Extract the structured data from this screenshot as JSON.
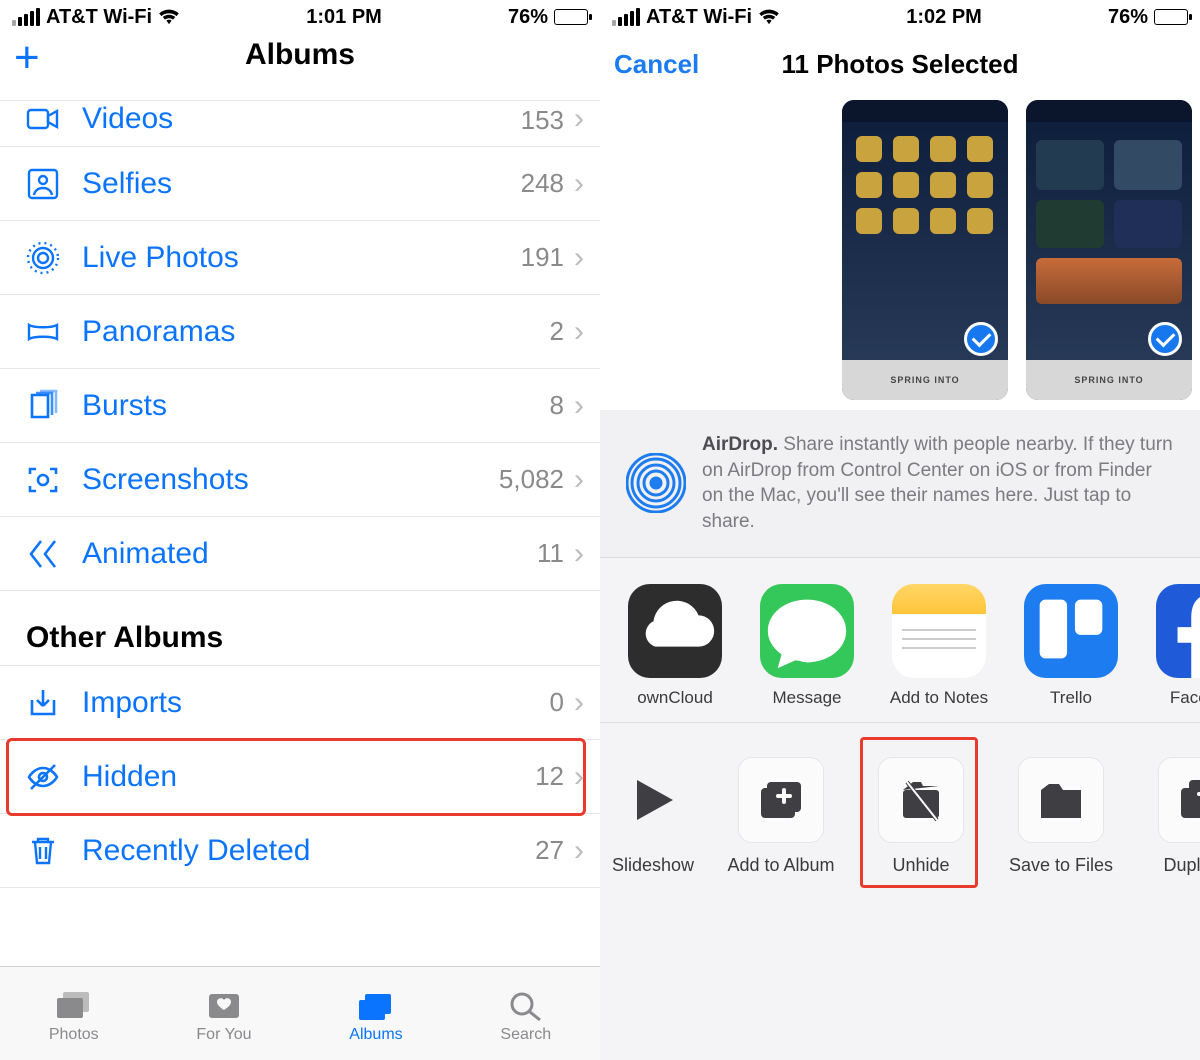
{
  "left": {
    "status": {
      "carrier": "AT&T Wi-Fi",
      "time": "1:01 PM",
      "battery": "76%"
    },
    "nav": {
      "title": "Albums"
    },
    "media_types": [
      {
        "icon": "video-icon",
        "name": "Videos",
        "count": "153"
      },
      {
        "icon": "selfie-icon",
        "name": "Selfies",
        "count": "248"
      },
      {
        "icon": "livephoto-icon",
        "name": "Live Photos",
        "count": "191"
      },
      {
        "icon": "panorama-icon",
        "name": "Panoramas",
        "count": "2"
      },
      {
        "icon": "burst-icon",
        "name": "Bursts",
        "count": "8"
      },
      {
        "icon": "screenshot-icon",
        "name": "Screenshots",
        "count": "5,082"
      },
      {
        "icon": "animated-icon",
        "name": "Animated",
        "count": "11"
      }
    ],
    "other_section_title": "Other Albums",
    "other_albums": [
      {
        "icon": "import-icon",
        "name": "Imports",
        "count": "0"
      },
      {
        "icon": "hidden-icon",
        "name": "Hidden",
        "count": "12",
        "highlighted": true
      },
      {
        "icon": "trash-icon",
        "name": "Recently Deleted",
        "count": "27"
      }
    ],
    "tabs": [
      {
        "name": "Photos",
        "active": false
      },
      {
        "name": "For You",
        "active": false
      },
      {
        "name": "Albums",
        "active": true
      },
      {
        "name": "Search",
        "active": false
      }
    ]
  },
  "right": {
    "status": {
      "carrier": "AT&T Wi-Fi",
      "time": "1:02 PM",
      "battery": "76%"
    },
    "nav": {
      "cancel": "Cancel",
      "title": "11 Photos Selected"
    },
    "airdrop_bold": "AirDrop.",
    "airdrop_text": " Share instantly with people nearby. If they turn on AirDrop from Control Center on iOS or from Finder on the Mac, you'll see their names here. Just tap to share.",
    "apps": [
      {
        "name": "ownCloud",
        "bg": "#2d2d2d",
        "glyph": "cloud"
      },
      {
        "name": "Message",
        "bg": "#34c759",
        "glyph": "bubble"
      },
      {
        "name": "Add to Notes",
        "bg": "linear-gradient(#ffd666,#ffc53a)",
        "glyph": "notes"
      },
      {
        "name": "Trello",
        "bg": "#1d7cf0",
        "glyph": "trello"
      },
      {
        "name": "Faceboo",
        "bg": "#1f5bd8",
        "glyph": "fb"
      }
    ],
    "actions": [
      {
        "name": "Slideshow",
        "glyph": "play"
      },
      {
        "name": "Add to Album",
        "glyph": "addalbum"
      },
      {
        "name": "Unhide",
        "glyph": "unhide",
        "highlighted": true
      },
      {
        "name": "Save to Files",
        "glyph": "folder"
      },
      {
        "name": "Duplicate",
        "glyph": "duplicate"
      }
    ]
  }
}
